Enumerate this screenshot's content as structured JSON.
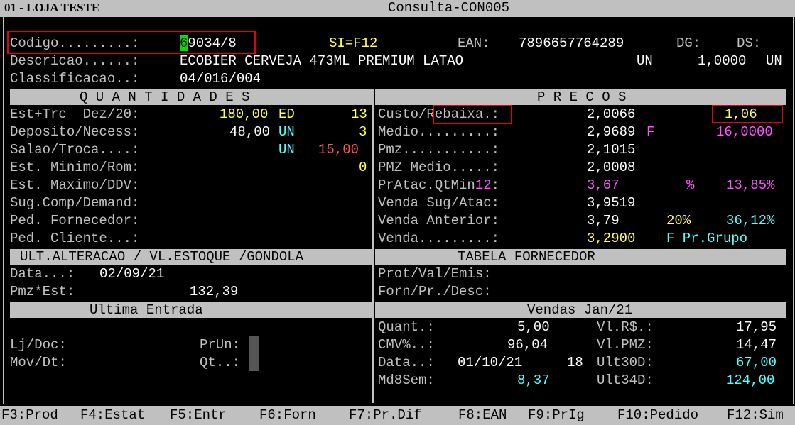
{
  "window": {
    "store": "01 - LOJA TESTE",
    "title": "Consulta-CON005"
  },
  "header": {
    "codigo_label": "Codigo.........:",
    "codigo_cursor": "6",
    "codigo_rest": "9034/8",
    "si_label": "SI=F12",
    "ean_label": "EAN:",
    "ean_value": "7896657764289",
    "dg_label": "DG:",
    "ds_label": "DS:",
    "descricao_label": "Descricao......:",
    "descricao_value": "ECOBIER CERVEJA 473ML PREMIUM LATAO",
    "unit_left": "UN",
    "unit_qty": "1,0000",
    "unit_right": "UN",
    "classif_label": "Classificacao..:",
    "classif_value": "04/016/004"
  },
  "sections": {
    "quantidades": "Q U A N T I D A D E S",
    "precos": "P R E C O S",
    "ult_alteracao": "ULT.ALTERACAO / VL.ESTOQUE /GONDOLA",
    "tabela_fornecedor": "TABELA FORNECEDOR",
    "ultima_entrada": "Ultima Entrada",
    "vendas": "Vendas Jan/21"
  },
  "quantidades": {
    "r1_label": "Est+Trc  Dez/20:",
    "r1_val": "180,00",
    "r1_unit": "ED",
    "r1_n": "13",
    "r2_label": "Deposito/Necess:",
    "r2_val": "48,00",
    "r2_unit": "UN",
    "r2_n": "3",
    "r3_label": "Salao/Troca....:",
    "r3_unit": "UN",
    "r3_val": "15,00",
    "r4_label": "Est. Minimo/Rom:",
    "r4_val": "0",
    "r5_label": "Est. Maximo/DDV:",
    "r6_label": "Sug.Comp/Demand:",
    "r7_label": "Ped. Fornecedor:",
    "r8_label": "Ped. Cliente...:"
  },
  "precos": {
    "r1_label_a": "Custo/",
    "r1_label_b": "Rebaixa",
    "r1_label_c": ".:",
    "r1_val": "2,0066",
    "r1_right": "1,06",
    "r2_label": "Medio.........:",
    "r2_val": "2,9689",
    "r2_flag": "F",
    "r2_right": "16,0000",
    "r3_label": "Pmz...........:",
    "r3_val": "2,1015",
    "r4_label": "PMZ Medio.....:",
    "r4_val": "2,0008",
    "r5_label": "PrAtac.QtMin",
    "r5_qt": "12",
    "r5_colon": ":",
    "r5_val": "3,67",
    "r5_pct": "%",
    "r5_right": "13,85%",
    "r6_label": "Venda Sug/Atac:",
    "r6_val": "3,9519",
    "r7_label": "Venda Anterior:",
    "r7_val": "3,79",
    "r7_pct": "20%",
    "r7_right": "36,12%",
    "r8_label": "Venda.........:",
    "r8_val": "3,2900",
    "r8_right": "F Pr.Grupo"
  },
  "ult_alt": {
    "data_label": "Data...:",
    "data_value": "02/09/21",
    "pmz_label": "Pmz*Est:",
    "pmz_value": "132,39"
  },
  "tab_forn": {
    "prot_label": "Prot/Val/Emis:",
    "forn_label": "Forn/Pr./Desc:"
  },
  "ult_entrada": {
    "lj_label": "Lj/Doc:",
    "prun_label": "PrUn:",
    "mov_label": "Mov/Dt:",
    "qt_label": "Qt..:"
  },
  "vendas": {
    "quant_label": "Quant.:",
    "quant_val": "5,00",
    "vlrs_label": "Vl.R$.:",
    "vlrs_val": "17,95",
    "cmv_label": "CMV%..:",
    "cmv_val": "96,04",
    "vlpmz_label": "Vl.PMZ:",
    "vlpmz_val": "14,47",
    "data_label": "Data..:",
    "data_val": "01/10/21",
    "data_n": "18",
    "ult30_label": "Ult30D:",
    "ult30_val": "67,00",
    "md8_label": "Md8Sem:",
    "md8_val": "8,37",
    "ult34_label": "Ult34D:",
    "ult34_val": "124,00"
  },
  "fkeys": [
    "F3:Prod",
    "F4:Estat",
    "F5:Entr",
    "F6:Forn",
    "F7:Pr.Dif",
    "F8:EAN",
    "F9:PrIg",
    "F10:Pedido",
    "F12:Sim"
  ]
}
